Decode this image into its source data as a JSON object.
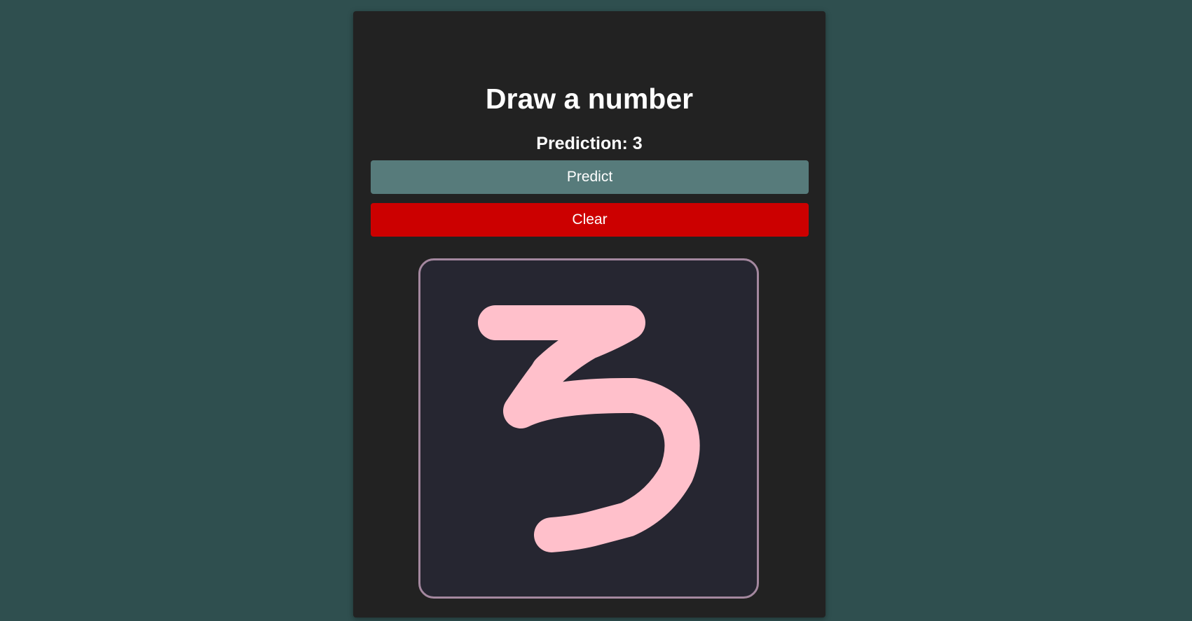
{
  "app": {
    "title": "Draw a number"
  },
  "prediction": {
    "text": "Prediction: 3"
  },
  "buttons": {
    "predict_label": "Predict",
    "clear_label": "Clear"
  },
  "canvas": {
    "stroke_color": "#ffc0cb",
    "background_color": "#262631",
    "border_color": "#a4889f"
  },
  "colors": {
    "page_background": "#2f4f4f",
    "panel_background": "#222222",
    "predict_button": "#577b7b",
    "clear_button": "#cc0000"
  }
}
